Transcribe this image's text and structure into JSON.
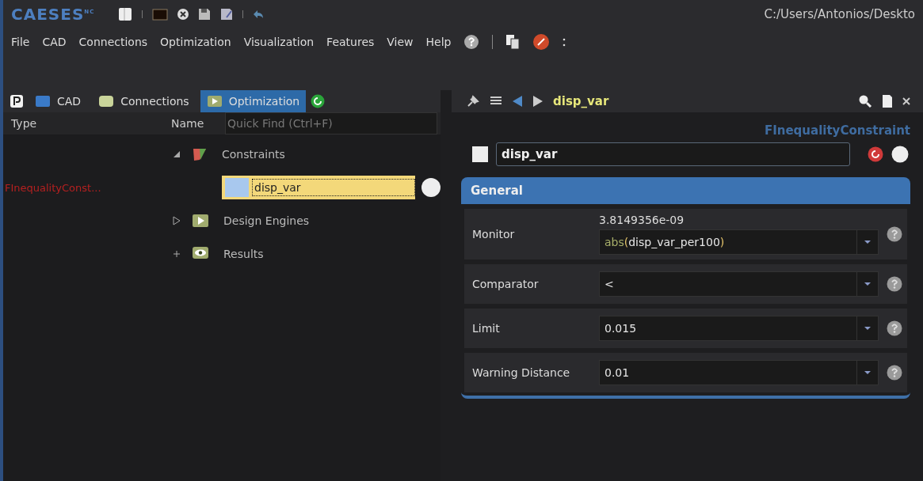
{
  "title_bar": {
    "logo": "CAESES",
    "logo_mark": "NC",
    "path": "C:/Users/Antonios/Deskto"
  },
  "menu": [
    "File",
    "CAD",
    "Connections",
    "Optimization",
    "Visualization",
    "Features",
    "View",
    "Help"
  ],
  "left_panel": {
    "tabs": [
      {
        "label": "CAD",
        "kind": "cad",
        "selected": false
      },
      {
        "label": "Connections",
        "kind": "connections",
        "selected": false
      },
      {
        "label": "Optimization",
        "kind": "optimization",
        "selected": true
      }
    ],
    "type_header": "Type",
    "name_header": "Name",
    "search": {
      "placeholder": "Quick Find (Ctrl+F)"
    },
    "tree": [
      {
        "label": "Constraints",
        "kind": "constraints",
        "expanded": true,
        "selected": false,
        "children": [
          {
            "label": "disp_var",
            "type": "FInequalityConst...",
            "selected": true
          }
        ]
      },
      {
        "label": "Design Engines",
        "kind": "engines",
        "expanded": false,
        "selected": false
      },
      {
        "label": "Results",
        "kind": "results",
        "expanded": false,
        "selected": false
      }
    ]
  },
  "right_panel": {
    "title": "disp_var",
    "class_name": "FInequalityConstraint",
    "name_value": "disp_var",
    "section": "General",
    "rows": [
      {
        "label": "Monitor",
        "reading": "3.8149356e-09",
        "tokens": [
          {
            "kind": "function",
            "text": "abs"
          },
          {
            "kind": "paren",
            "text": "("
          },
          {
            "kind": "name",
            "text": "disp_var_per100"
          },
          {
            "kind": "paren",
            "text": ")"
          }
        ]
      },
      {
        "label": "Comparator",
        "tokens": [
          {
            "kind": "name",
            "text": "<"
          }
        ]
      },
      {
        "label": "Limit",
        "tokens": [
          {
            "kind": "name",
            "text": "0.015"
          }
        ]
      },
      {
        "label": "Warning Distance",
        "tokens": [
          {
            "kind": "name",
            "text": "0.01"
          }
        ]
      }
    ]
  }
}
